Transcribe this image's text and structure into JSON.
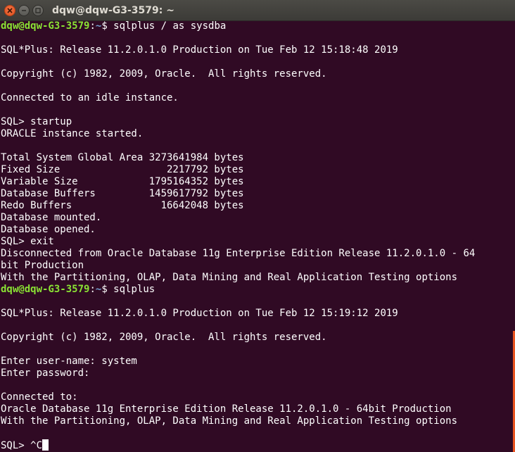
{
  "window": {
    "title": "dqw@dqw-G3-3579: ~",
    "colors": {
      "background": "#300a24",
      "foreground": "#ffffff",
      "prompt_user": "#8ae234",
      "prompt_path": "#729fcf",
      "scrollbar": "#e95420"
    }
  },
  "terminal": {
    "lines": [
      {
        "type": "prompt",
        "user": "dqw@dqw-G3-3579",
        "path": "~",
        "command": "sqlplus / as sysdba"
      },
      {
        "type": "text",
        "text": ""
      },
      {
        "type": "text",
        "text": "SQL*Plus: Release 11.2.0.1.0 Production on Tue Feb 12 15:18:48 2019"
      },
      {
        "type": "text",
        "text": ""
      },
      {
        "type": "text",
        "text": "Copyright (c) 1982, 2009, Oracle.  All rights reserved."
      },
      {
        "type": "text",
        "text": ""
      },
      {
        "type": "text",
        "text": "Connected to an idle instance."
      },
      {
        "type": "text",
        "text": ""
      },
      {
        "type": "text",
        "text": "SQL> startup"
      },
      {
        "type": "text",
        "text": "ORACLE instance started."
      },
      {
        "type": "text",
        "text": ""
      },
      {
        "type": "text",
        "text": "Total System Global Area 3273641984 bytes"
      },
      {
        "type": "text",
        "text": "Fixed Size                  2217792 bytes"
      },
      {
        "type": "text",
        "text": "Variable Size            1795164352 bytes"
      },
      {
        "type": "text",
        "text": "Database Buffers         1459617792 bytes"
      },
      {
        "type": "text",
        "text": "Redo Buffers               16642048 bytes"
      },
      {
        "type": "text",
        "text": "Database mounted."
      },
      {
        "type": "text",
        "text": "Database opened."
      },
      {
        "type": "text",
        "text": "SQL> exit"
      },
      {
        "type": "text",
        "text": "Disconnected from Oracle Database 11g Enterprise Edition Release 11.2.0.1.0 - 64"
      },
      {
        "type": "text",
        "text": "bit Production"
      },
      {
        "type": "text",
        "text": "With the Partitioning, OLAP, Data Mining and Real Application Testing options"
      },
      {
        "type": "prompt",
        "user": "dqw@dqw-G3-3579",
        "path": "~",
        "command": "sqlplus"
      },
      {
        "type": "text",
        "text": ""
      },
      {
        "type": "text",
        "text": "SQL*Plus: Release 11.2.0.1.0 Production on Tue Feb 12 15:19:12 2019"
      },
      {
        "type": "text",
        "text": ""
      },
      {
        "type": "text",
        "text": "Copyright (c) 1982, 2009, Oracle.  All rights reserved."
      },
      {
        "type": "text",
        "text": ""
      },
      {
        "type": "text",
        "text": "Enter user-name: system"
      },
      {
        "type": "text",
        "text": "Enter password: "
      },
      {
        "type": "text",
        "text": ""
      },
      {
        "type": "text",
        "text": "Connected to:"
      },
      {
        "type": "text",
        "text": "Oracle Database 11g Enterprise Edition Release 11.2.0.1.0 - 64bit Production"
      },
      {
        "type": "text",
        "text": "With the Partitioning, OLAP, Data Mining and Real Application Testing options"
      },
      {
        "type": "text",
        "text": ""
      },
      {
        "type": "input",
        "text": "SQL> ^C"
      }
    ]
  }
}
